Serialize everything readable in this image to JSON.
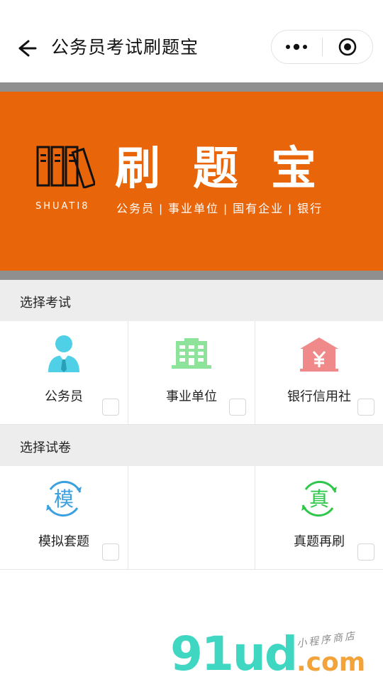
{
  "navbar": {
    "title": "公务员考试刷题宝",
    "back_icon": "arrow-left-icon",
    "more_icon": "more-dots-icon",
    "close_icon": "target-circle-icon"
  },
  "banner": {
    "logo_text": "SHUATI8",
    "brand_chars": [
      "刷",
      "题",
      "宝"
    ],
    "tagline": "公务员 | 事业单位 | 国有企业 | 银行",
    "colors": {
      "background": "#e8650a",
      "frame": "#8f8f8f"
    }
  },
  "exam_section": {
    "title": "选择考试",
    "items": [
      {
        "label": "公务员",
        "icon": "civil-servant-person-icon",
        "color": "#4fd0e6"
      },
      {
        "label": "事业单位",
        "icon": "office-building-icon",
        "color": "#8ee39a"
      },
      {
        "label": "银行信用社",
        "icon": "bank-yen-icon",
        "color": "#f08a8a"
      }
    ]
  },
  "paper_section": {
    "title": "选择试卷",
    "items": [
      {
        "label": "模拟套题",
        "icon_text": "模",
        "icon": "mock-exam-icon",
        "color": "#3aa0e0"
      },
      {
        "label": "真题再刷",
        "icon_text": "真",
        "icon": "real-exam-icon",
        "color": "#2ec74a"
      }
    ]
  },
  "watermark": {
    "main": "91ud",
    "domain": ".com",
    "note": "小程序商店"
  }
}
